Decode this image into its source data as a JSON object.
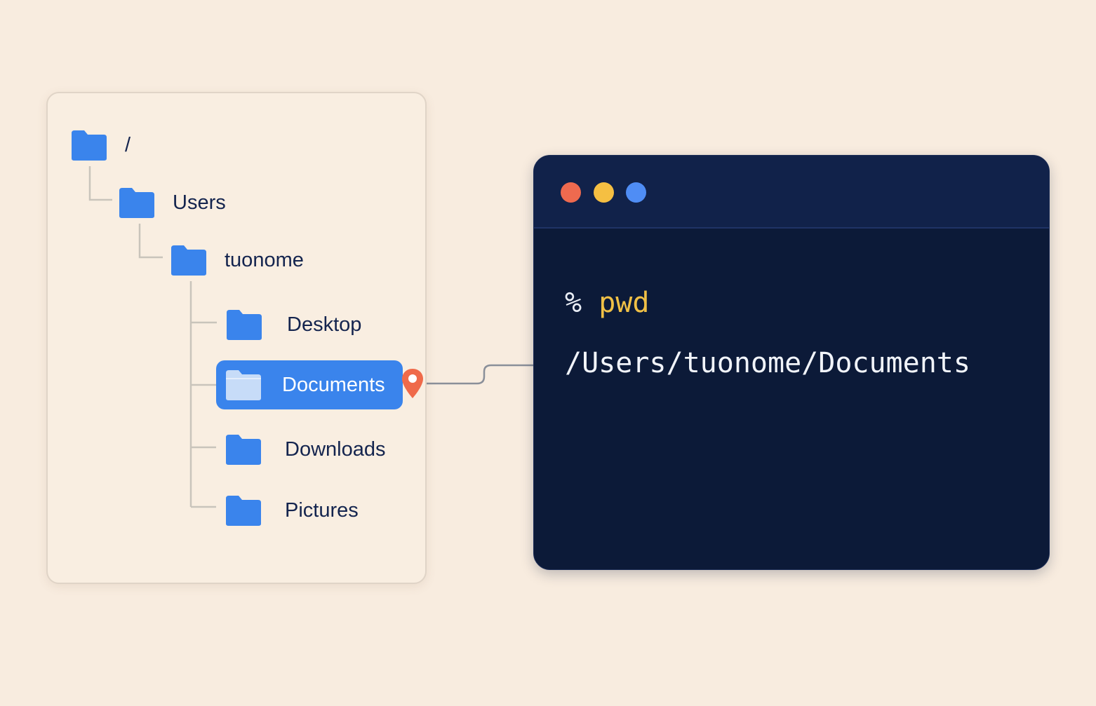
{
  "tree": {
    "items": [
      {
        "label": "/",
        "icon": "folder-icon"
      },
      {
        "label": "Users",
        "icon": "folder-icon"
      },
      {
        "label": "tuonome",
        "icon": "folder-icon"
      },
      {
        "label": "Desktop",
        "icon": "folder-icon"
      },
      {
        "label": "Documents",
        "icon": "folder-open-icon",
        "selected": true
      },
      {
        "label": "Downloads",
        "icon": "folder-icon"
      },
      {
        "label": "Pictures",
        "icon": "folder-icon"
      }
    ],
    "marker_icon": "location-pin-icon"
  },
  "terminal": {
    "window_buttons": [
      "close",
      "minimize",
      "zoom"
    ],
    "prompt": "%",
    "command": "pwd",
    "output": "/Users/tuonome/Documents"
  },
  "colors": {
    "background": "#f8ecdf",
    "folder": "#3a84ec",
    "selected": "#3a84ec",
    "terminal_bg": "#0c1a38",
    "command": "#f0c046",
    "pin": "#ef6a4a",
    "close": "#ee6a4f",
    "minimize": "#f5bf42",
    "zoom": "#4f8df5"
  }
}
